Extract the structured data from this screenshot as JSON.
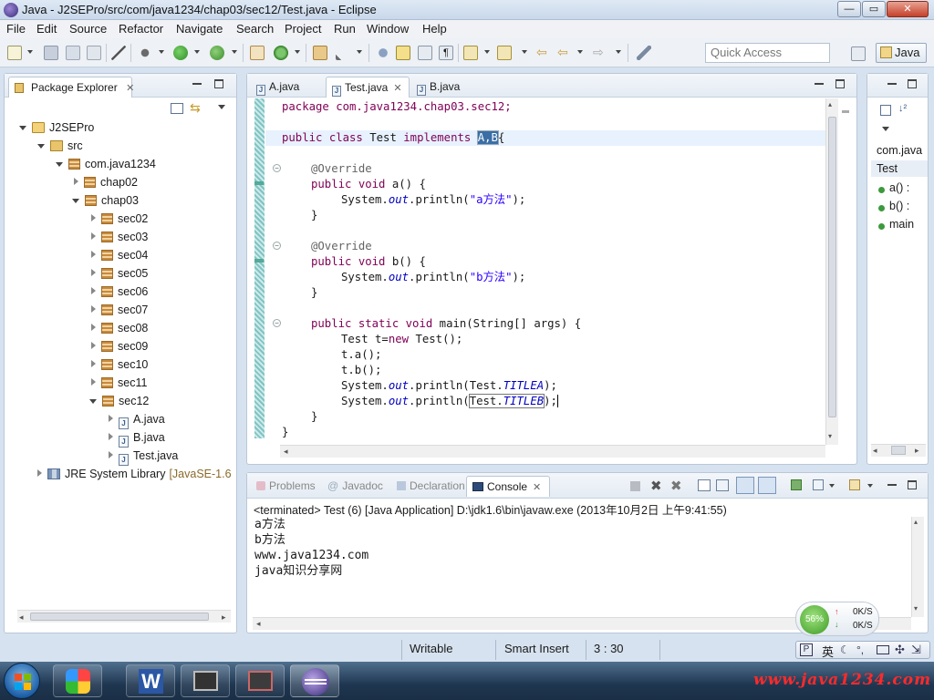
{
  "window": {
    "title": "Java - J2SEPro/src/com/java1234/chap03/sec12/Test.java - Eclipse",
    "controls": {
      "minimize": "—",
      "maximize": "▭",
      "close": "✕"
    }
  },
  "menu": [
    "File",
    "Edit",
    "Source",
    "Refactor",
    "Navigate",
    "Search",
    "Project",
    "Run",
    "Window",
    "Help"
  ],
  "toolbar": {
    "quick_access_placeholder": "Quick Access",
    "perspective_label": "Java"
  },
  "package_explorer": {
    "title": "Package Explorer",
    "tree": [
      {
        "label": "J2SEPro",
        "icon": "project-icon",
        "twist": "open",
        "level": 0
      },
      {
        "label": "src",
        "icon": "source-folder-icon",
        "twist": "open",
        "level": 1
      },
      {
        "label": "com.java1234",
        "icon": "package-icon",
        "twist": "open",
        "level": 2
      },
      {
        "label": "chap02",
        "icon": "package-icon",
        "twist": "closed",
        "level": 3
      },
      {
        "label": "chap03",
        "icon": "package-icon",
        "twist": "open",
        "level": 3
      },
      {
        "label": "sec02",
        "icon": "package-icon",
        "twist": "closed",
        "level": 4
      },
      {
        "label": "sec03",
        "icon": "package-icon",
        "twist": "closed",
        "level": 4
      },
      {
        "label": "sec04",
        "icon": "package-icon",
        "twist": "closed",
        "level": 4
      },
      {
        "label": "sec05",
        "icon": "package-icon",
        "twist": "closed",
        "level": 4
      },
      {
        "label": "sec06",
        "icon": "package-icon",
        "twist": "closed",
        "level": 4
      },
      {
        "label": "sec07",
        "icon": "package-icon",
        "twist": "closed",
        "level": 4
      },
      {
        "label": "sec08",
        "icon": "package-icon",
        "twist": "closed",
        "level": 4
      },
      {
        "label": "sec09",
        "icon": "package-icon",
        "twist": "closed",
        "level": 4
      },
      {
        "label": "sec10",
        "icon": "package-icon",
        "twist": "closed",
        "level": 4
      },
      {
        "label": "sec11",
        "icon": "package-icon",
        "twist": "closed",
        "level": 4
      },
      {
        "label": "sec12",
        "icon": "package-icon",
        "twist": "open",
        "level": 4
      },
      {
        "label": "A.java",
        "icon": "java-file-icon",
        "twist": "closed",
        "level": 5
      },
      {
        "label": "B.java",
        "icon": "java-file-icon",
        "twist": "closed",
        "level": 5
      },
      {
        "label": "Test.java",
        "icon": "java-file-icon",
        "twist": "closed",
        "level": 5
      },
      {
        "label": "JRE System Library",
        "suffix": "[JavaSE-1.6",
        "icon": "library-icon",
        "twist": "closed",
        "level": 1
      }
    ]
  },
  "editor": {
    "tabs": [
      {
        "label": "A.java",
        "active": false
      },
      {
        "label": "Test.java",
        "active": true
      },
      {
        "label": "B.java",
        "active": false
      }
    ],
    "lines": {
      "l1": "package com.java1234.chap03.sec12;",
      "l2_kw": "public class",
      "l2_name": " Test ",
      "l2_impl": "implements",
      "l2_sel": "A,B",
      "l2_end": "{",
      "ann": "@Override",
      "a_sig_kw": "public void",
      "a_sig_rest": " a() {",
      "sys": "System.",
      "out": "out",
      "println": ".println(",
      "a_str": "\"a方法\"",
      "end_stmt": ");",
      "brace_close": "}",
      "b_sig_rest": " b() {",
      "b_str": "\"b方法\"",
      "main_kw": "public static void",
      "main_rest": " main(String[] args) {",
      "new_line_a": "Test t=",
      "new_kw": "new",
      "new_line_b": " Test();",
      "ta": "t.a();",
      "tb": "t.b();",
      "test_dot": "Test.",
      "titlea": "TITLEA",
      "titleb": "TITLEB"
    }
  },
  "outline": {
    "package": "com.java",
    "class": "Test",
    "members": [
      "a() :",
      "b() :",
      "main"
    ]
  },
  "bottom": {
    "tabs": [
      "Problems",
      "Javadoc",
      "Declaration",
      "Console"
    ],
    "active_tab": "Console",
    "terminated": "<terminated> Test (6) [Java Application] D:\\jdk1.6\\bin\\javaw.exe (2013年10月2日 上午9:41:55)",
    "output": [
      "a方法",
      "b方法",
      "www.java1234.com",
      "java知识分享网"
    ]
  },
  "status": {
    "writable": "Writable",
    "insert_mode": "Smart Insert",
    "position": "3 : 30"
  },
  "overlays": {
    "memory_percent": "56%",
    "net_up": "0K/S",
    "net_down": "0K/S",
    "ime_lang": "英",
    "watermark": "www.java1234.com"
  },
  "colors": {
    "keyword": "#7f0055",
    "string": "#2a00ff",
    "field": "#0000c0",
    "annotation": "#646464"
  }
}
